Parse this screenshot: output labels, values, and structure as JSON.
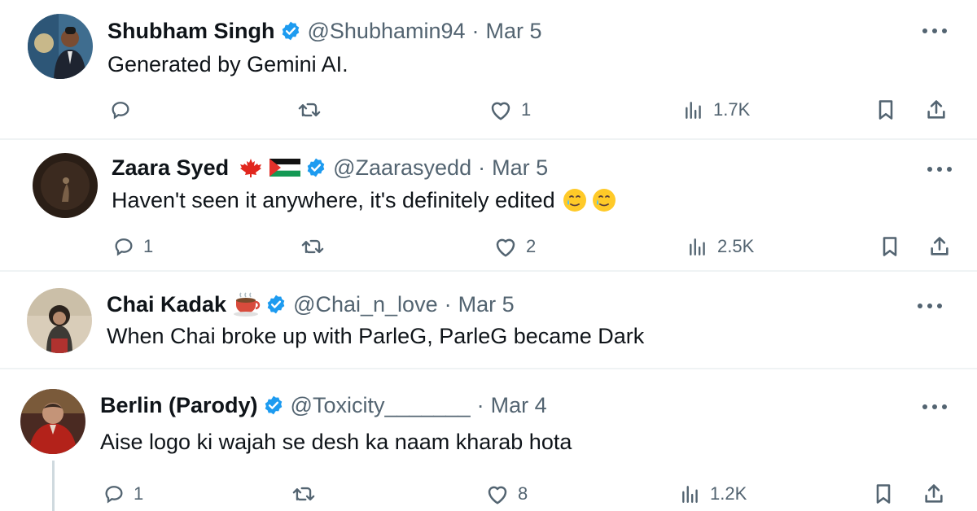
{
  "tweets": [
    {
      "name": "Shubham Singh",
      "handle": "@Shubhamin94",
      "separator": "·",
      "date": "Mar 5",
      "text": "Generated by Gemini AI.",
      "replies": "",
      "likes": "1",
      "views": "1.7K",
      "icons": [
        "verified-badge",
        "reply-icon",
        "retweet-icon",
        "like-icon",
        "views-icon",
        "bookmark-icon",
        "share-icon",
        "more-icon"
      ]
    },
    {
      "name": "Zaara Syed",
      "name_emojis": [
        "canada-flag",
        "palestine-flag"
      ],
      "handle": "@Zaarasyedd",
      "separator": "·",
      "date": "Mar 5",
      "text": "Haven't seen it anywhere, it's definitely edited",
      "text_emojis": [
        "tear-smile",
        "tear-smile"
      ],
      "replies": "1",
      "likes": "2",
      "views": "2.5K"
    },
    {
      "name": "Chai Kadak",
      "name_emojis": [
        "hot-beverage"
      ],
      "handle": "@Chai_n_love",
      "separator": "·",
      "date": "Mar 5",
      "text": "When Chai broke up with ParleG, ParleG became Dark"
    },
    {
      "name": "Berlin (Parody)",
      "handle": "@Toxicity_______",
      "separator": "·",
      "date": "Mar 4",
      "text": "Aise logo ki wajah se desh ka naam kharab hota",
      "replies": "1",
      "likes": "8",
      "views": "1.2K"
    }
  ],
  "colors": {
    "verified": "#1d9bf0",
    "text_primary": "#0f1419",
    "text_secondary": "#536471",
    "divider": "#eff3f4",
    "thread_line": "#cfd9de"
  }
}
